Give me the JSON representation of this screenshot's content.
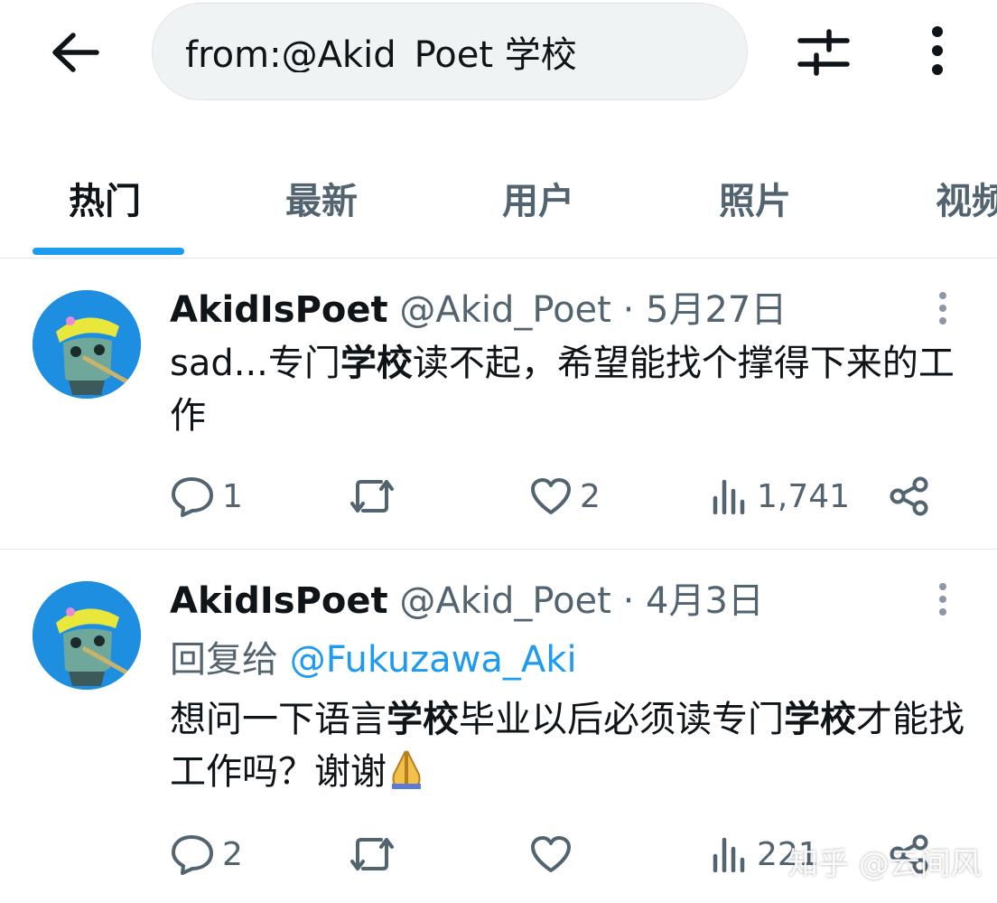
{
  "header": {
    "search_value": "from:@Akid_Poet 学校",
    "back_icon": "arrow-left-icon",
    "filter_icon": "sliders-icon",
    "more_icon": "more-vertical-icon"
  },
  "tabs": [
    {
      "label": "热门",
      "active": true
    },
    {
      "label": "最新",
      "active": false
    },
    {
      "label": "用户",
      "active": false
    },
    {
      "label": "照片",
      "active": false
    },
    {
      "label": "视频",
      "active": false
    }
  ],
  "colors": {
    "accent": "#1d9bf0",
    "text_primary": "#0f1419",
    "text_secondary": "#536471",
    "search_bg": "#eff3f4"
  },
  "tweets": [
    {
      "name": "AkidIsPoet",
      "handle": "@Akid_Poet",
      "dot": "·",
      "date": "5月27日",
      "text_parts": [
        "sad...专门",
        "学校",
        "读不起，希望能找个撑得下来的工作"
      ],
      "counts": {
        "reply": "1",
        "retweet": "",
        "like": "2",
        "views": "1,741"
      }
    },
    {
      "name": "AkidIsPoet",
      "handle": "@Akid_Poet",
      "dot": "·",
      "date": "4月3日",
      "reply_prefix": "回复给",
      "reply_to": "@Fukuzawa_Aki",
      "text_parts": [
        "想问一下语言",
        "学校",
        "毕业以后必须读专门",
        "学校",
        "才能找工作吗？谢谢"
      ],
      "emoji": "folded-hands-icon",
      "counts": {
        "reply": "2",
        "retweet": "",
        "like": "",
        "views": "221"
      }
    }
  ],
  "watermark": "知乎 @云间风"
}
